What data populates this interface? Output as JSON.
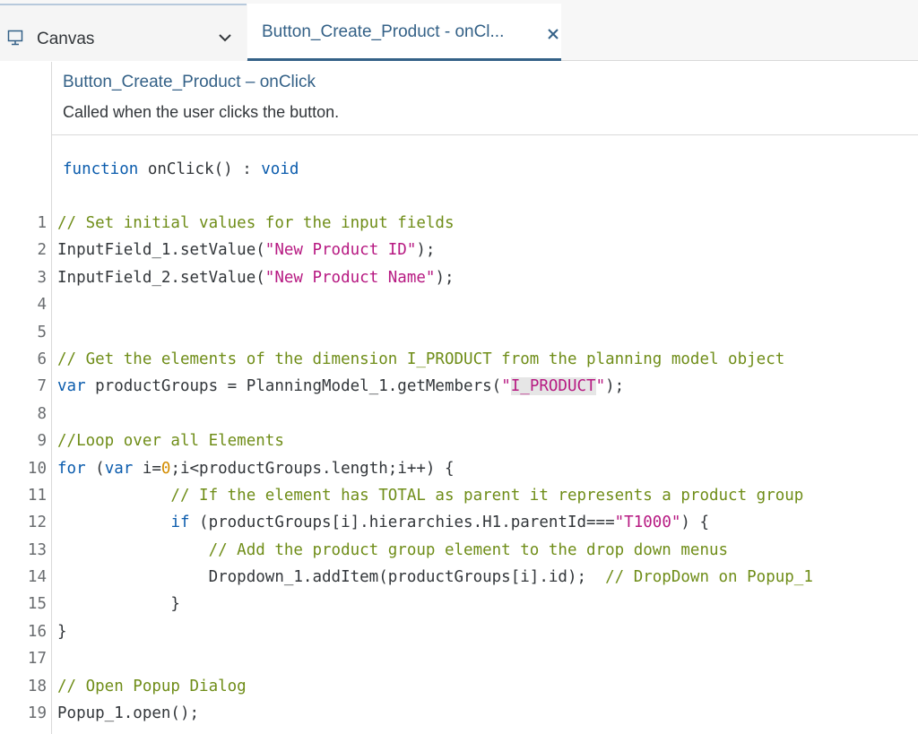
{
  "tabs": {
    "canvas": {
      "label": "Canvas",
      "icon": "canvas-icon"
    },
    "active": {
      "label": "Button_Create_Product - onCl...",
      "close_icon": "close-icon"
    }
  },
  "header": {
    "title": "Button_Create_Product – onClick",
    "description": "Called when the user clicks the button.",
    "signature": {
      "keyword_function": "function",
      "name": " onClick() : ",
      "return_type": "void"
    }
  },
  "code": {
    "line_numbers": [
      "1",
      "2",
      "3",
      "4",
      "5",
      "6",
      "7",
      "8",
      "9",
      "10",
      "11",
      "12",
      "13",
      "14",
      "15",
      "16",
      "17",
      "18",
      "19"
    ],
    "l1": "// Set initial values for the input fields",
    "l2a": "InputField_1.setValue(",
    "l2s": "\"New Product ID\"",
    "l2b": ");",
    "l3a": "InputField_2.setValue(",
    "l3s": "\"New Product Name\"",
    "l3b": ");",
    "l6": "// Get the elements of the dimension I_PRODUCT from the planning model object",
    "l7k": "var",
    "l7a": " productGroups = PlanningModel_1.getMembers(",
    "l7q1": "\"",
    "l7s": "I_PRODUCT",
    "l7q2": "\"",
    "l7b": ");",
    "l9": "//Loop over all Elements",
    "l10k": "for",
    "l10a": " (",
    "l10k2": "var",
    "l10b": " i=",
    "l10n": "0",
    "l10c": ";i<productGroups.length;i++) {",
    "l11": "            // If the element has TOTAL as parent it represents a product group",
    "l12pre": "            ",
    "l12k": "if",
    "l12a": " (productGroups[i].hierarchies.H1.parentId===",
    "l12s": "\"T1000\"",
    "l12b": ") {",
    "l13": "                // Add the product group element to the drop down menus",
    "l14a": "                Dropdown_1.addItem(productGroups[i].id);  ",
    "l14c": "// DropDown on Popup_1",
    "l15": "            }",
    "l16": "}",
    "l18": "// Open Popup Dialog",
    "l19": "Popup_1.open();"
  },
  "colors": {
    "accent": "#346187",
    "comment": "#6f8d18",
    "string": "#b71a82",
    "keyword": "#0b5cad",
    "number": "#d38c00"
  }
}
